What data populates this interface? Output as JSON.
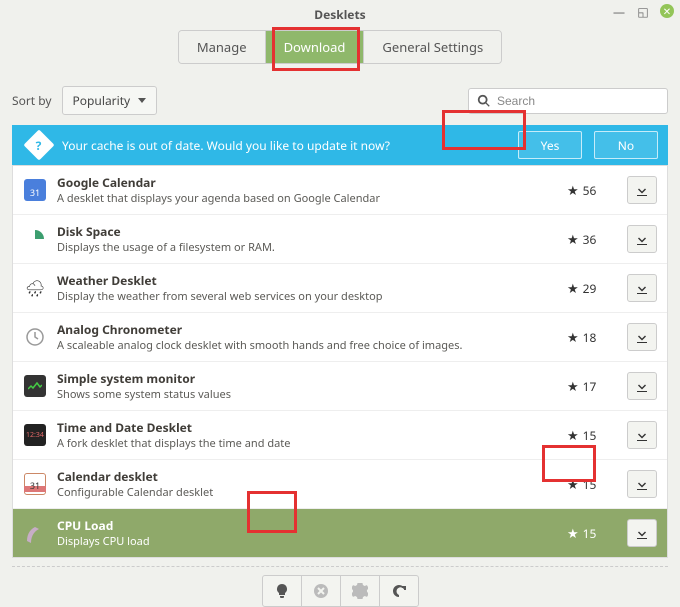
{
  "window": {
    "title": "Desklets"
  },
  "tabs": {
    "manage": "Manage",
    "download": "Download",
    "settings": "General Settings",
    "active": "download"
  },
  "sort": {
    "label": "Sort by",
    "value": "Popularity"
  },
  "search": {
    "placeholder": "Search"
  },
  "notice": {
    "text": "Your cache is out of date. Would you like to update it now?",
    "yes": "Yes",
    "no": "No"
  },
  "items": [
    {
      "name": "Google Calendar",
      "desc": "A desklet that displays your agenda based on Google Calendar",
      "stars": 56
    },
    {
      "name": "Disk Space",
      "desc": "Displays the usage of a filesystem or RAM.",
      "stars": 36
    },
    {
      "name": "Weather Desklet",
      "desc": "Display the weather from several web services on your desktop",
      "stars": 29
    },
    {
      "name": "Analog Chronometer",
      "desc": "A scaleable analog clock desklet with smooth hands and free choice of images.",
      "stars": 18
    },
    {
      "name": "Simple system monitor",
      "desc": "Shows some system status values",
      "stars": 17
    },
    {
      "name": "Time and Date Desklet",
      "desc": "A fork desklet that displays the time and date",
      "stars": 15
    },
    {
      "name": "Calendar desklet",
      "desc": "Configurable Calendar desklet",
      "stars": 15
    },
    {
      "name": "CPU Load",
      "desc": "Displays CPU load",
      "stars": 15
    }
  ]
}
